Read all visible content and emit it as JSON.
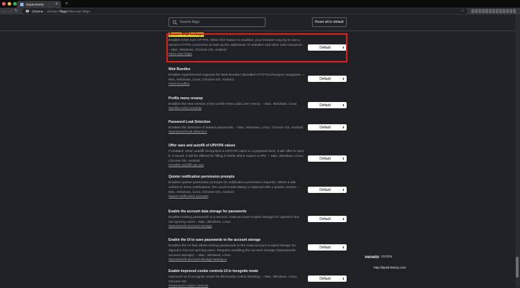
{
  "window": {
    "traffic_lights": [
      "#ff5f57",
      "#febc2e",
      "#28c840"
    ]
  },
  "tab": {
    "title": "Experiments",
    "close_icon": "close-icon"
  },
  "omnibox": {
    "origin": "Chrome",
    "separator": "|",
    "url_prefix": "chrome://",
    "url_bold": "flags",
    "url_rest": "/#dns-over-https"
  },
  "toolbar": {
    "extensions": [
      "",
      "",
      "",
      "",
      "",
      "",
      "",
      "",
      "",
      "",
      "",
      "",
      ""
    ]
  },
  "search": {
    "placeholder": "Search flags"
  },
  "reset_button": {
    "label": "Reset all to default"
  },
  "experiments": [
    {
      "title": "Secure DNS lookups",
      "description": "Enables DNS over HTTPS. When this feature is enabled, your browser may try to use a secure HTTPS connection to look up the addresses of websites and other web resources. – Mac, Windows, Chrome OS, Android",
      "link": "#dns-over-https",
      "value": "Default"
    },
    {
      "title": "Web Bundles",
      "description": "Enables experimental supports for Web Bundles (Bundled HTTP Exchanges) navigation. – Mac, Windows, Linux, Chrome OS, Android",
      "link": "#web-bundles",
      "value": "Default"
    },
    {
      "title": "Profile menu revamp",
      "description": "Enables the new version of the profile menu (aka user menu). – Mac, Windows, Linux",
      "link": "#profile-menu-revamp",
      "value": "Default"
    },
    {
      "title": "Password Leak Detection",
      "description": "Enables the detection of leaked passwords. – Mac, Windows, Linux, Chrome OS, Android",
      "link": "#password-leak-detection",
      "value": "Default"
    },
    {
      "title": "Offer save and autofill of UPI/VPA values",
      "description": "If enabled, when autofill recognizes a UPI/VPA value in a payment form, it will offer to save it. If saved, it will be offered for filling in fields which expect a VPA. – Mac, Windows, Linux, Chrome OS, Android",
      "link": "#enable-autofill-upi-vpa",
      "value": "Default"
    },
    {
      "title": "Quieter notification permission prompts",
      "description": "Enables quieter permission prompts for notification permission requests. When a site wishes to show notifications, the usual modal dialog is replaced with a quieter version. – Mac, Windows, Linux, Chrome OS, Android",
      "link": "#quiet-notification-prompts",
      "value": "Default"
    },
    {
      "title": "Enable the account data storage for passwords",
      "description": "Enables storing passwords in a second, Gaia-account-scoped storage for signed-in but not syncing users – Mac, Windows, Linux",
      "link": "#passwords-account-storage",
      "value": "Default"
    },
    {
      "title": "Enable the UI to save passwords to the account storage",
      "description": "Enables the UI that allows storing passwords to the Gaia-account-scoped storage for signed-in but not syncing users. Requires enabling the account storage (#passwords-account-storage). – Mac, Windows, Linux",
      "link": "#passwords-account-storage-saving-ui",
      "value": "Default"
    },
    {
      "title": "Enable improved cookie controls UI in incognito mode",
      "description": "Improved UI in Incognito mode for third-party cookie blocking. – Mac, Windows, Linux, Chrome OS",
      "link": "#improved-cookie-controls",
      "value": "Default"
    }
  ],
  "watermark": {
    "brand": "veneto",
    "sub": "CICO'N",
    "url": "http://tip48.tistory.com"
  }
}
